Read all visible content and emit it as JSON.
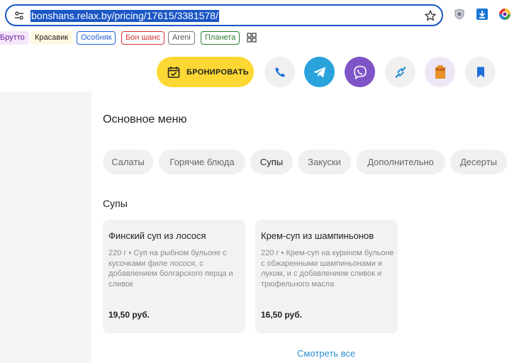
{
  "browser": {
    "url": "bonshans.relax.by/pricing/17615/3381578/",
    "bookmarks": [
      "Брутто",
      "Красавик",
      "Особняк",
      "Бон шанс",
      "Areni",
      "Планета"
    ]
  },
  "actionbar": {
    "book_label": "БРОНИРОВАТЬ",
    "icons": [
      "phone-icon",
      "telegram-icon",
      "viber-icon",
      "link-icon",
      "gift-icon",
      "bookmark-icon"
    ]
  },
  "menu": {
    "title": "Основное меню",
    "tabs": [
      "Салаты",
      "Горячие блюда",
      "Супы",
      "Закуски",
      "Дополнительно",
      "Десерты"
    ],
    "active_tab": "Супы"
  },
  "section": {
    "title": "Супы",
    "items": [
      {
        "name": "Финский суп из лосося",
        "description": "220 г • Суп на рыбном бульоне с кусочками филе лосося, с добавлением болгарского перца и сливок",
        "price": "19,50 руб."
      },
      {
        "name": "Крем-суп из шампиньонов",
        "description": "220 г • Крем-суп на курином бульоне с обжаренными шампиньонами и луком, и с добавлением сливок и трюфельного масла",
        "price": "16,50 руб."
      }
    ],
    "see_all": "Смотреть все"
  },
  "colors": {
    "accent_blue": "#1a56c5",
    "booking_yellow": "#fdd835",
    "telegram": "#2aa3dc",
    "viber": "#7d55c7",
    "link": "#2d8fd1"
  }
}
